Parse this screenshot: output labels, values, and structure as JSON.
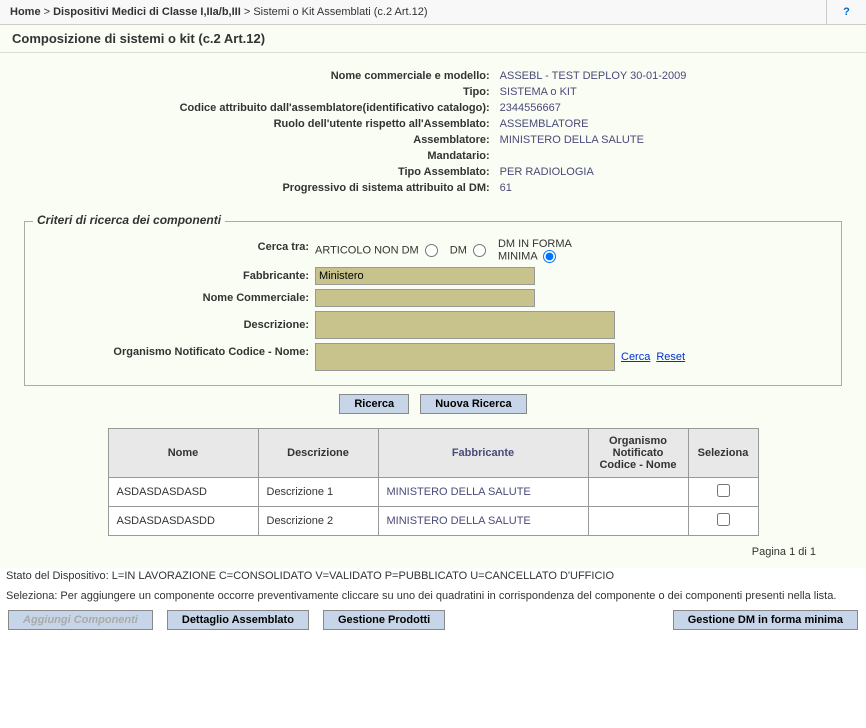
{
  "breadcrumb": {
    "home": "Home",
    "level1": "Dispositivi Medici di Classe I,IIa/b,III",
    "level2": "Sistemi o Kit Assemblati (c.2 Art.12)"
  },
  "help_icon": "?",
  "page_title": "Composizione di sistemi o kit (c.2 Art.12)",
  "details": {
    "labels": {
      "nome_commerciale": "Nome commerciale e modello:",
      "tipo": "Tipo:",
      "codice": "Codice attribuito dall'assemblatore(identificativo catalogo):",
      "ruolo": "Ruolo dell'utente rispetto all'Assemblato:",
      "assemblatore": "Assemblatore:",
      "mandatario": "Mandatario:",
      "tipo_assemblato": "Tipo Assemblato:",
      "progressivo": "Progressivo di sistema attribuito al DM:"
    },
    "values": {
      "nome_commerciale": "ASSEBL - TEST DEPLOY 30-01-2009",
      "tipo": "SISTEMA o KIT",
      "codice": "2344556667",
      "ruolo": "ASSEMBLATORE",
      "assemblatore": "MINISTERO DELLA SALUTE",
      "mandatario": "",
      "tipo_assemblato": "PER RADIOLOGIA",
      "progressivo": "61"
    }
  },
  "search": {
    "legend": "Criteri di ricerca dei componenti",
    "labels": {
      "cerca_tra": "Cerca tra:",
      "fabbricante": "Fabbricante:",
      "nome_commerciale": "Nome Commerciale:",
      "descrizione": "Descrizione:",
      "organismo": "Organismo Notificato Codice - Nome:"
    },
    "radios": {
      "opt1": "ARTICOLO NON DM",
      "opt2": "DM",
      "opt3": "DM IN FORMA MINIMA",
      "selected": "opt3"
    },
    "values": {
      "fabbricante": "Ministero",
      "nome_commerciale": "",
      "descrizione": "",
      "organismo": ""
    },
    "links": {
      "cerca": "Cerca",
      "reset": "Reset"
    },
    "buttons": {
      "ricerca": "Ricerca",
      "nuova": "Nuova Ricerca"
    }
  },
  "results": {
    "headers": {
      "nome": "Nome",
      "descrizione": "Descrizione",
      "fabbricante": "Fabbricante",
      "organismo": "Organismo Notificato Codice - Nome",
      "seleziona": "Seleziona"
    },
    "rows": [
      {
        "nome": "ASDASDASDASD",
        "descrizione": "Descrizione 1",
        "fabbricante": "MINISTERO DELLA SALUTE",
        "organismo": "",
        "selected": false
      },
      {
        "nome": "ASDASDASDASDD",
        "descrizione": "Descrizione 2",
        "fabbricante": "MINISTERO DELLA SALUTE",
        "organismo": "",
        "selected": false
      }
    ]
  },
  "pager": "Pagina 1 di 1",
  "status_line": "Stato del Dispositivo: L=IN LAVORAZIONE C=CONSOLIDATO V=VALIDATO P=PUBBLICATO U=CANCELLATO D'UFFICIO",
  "help_line": "Seleziona: Per aggiungere un componente occorre preventivamente cliccare su uno dei quadratini in corrispondenza del componente o dei componenti presenti nella lista.",
  "actions": {
    "aggiungi": "Aggiungi Componenti",
    "dettaglio": "Dettaglio Assemblato",
    "gestione_prodotti": "Gestione Prodotti",
    "gestione_dm": "Gestione DM in forma minima"
  }
}
